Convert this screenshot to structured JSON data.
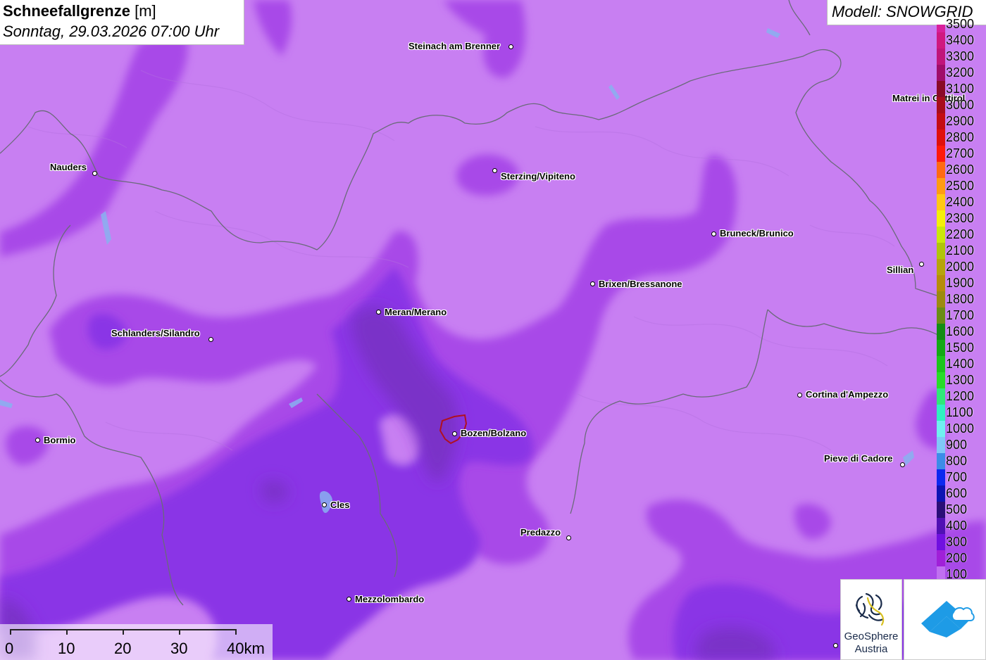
{
  "title": {
    "parameter": "Schneefallgrenze",
    "unit": "[m]",
    "datetime": "Sonntag, 29.03.2026 07:00 Uhr"
  },
  "model": "Modell: SNOWGRID",
  "cities": [
    {
      "name": "Steinach am Brenner"
    },
    {
      "name": "Matrei in Osttirol"
    },
    {
      "name": "Nauders"
    },
    {
      "name": "Sterzing/Vipiteno"
    },
    {
      "name": "Bruneck/Brunico"
    },
    {
      "name": "Sillian"
    },
    {
      "name": "Brixen/Bressanone"
    },
    {
      "name": "Meran/Merano"
    },
    {
      "name": "Schlanders/Silandro"
    },
    {
      "name": "Cortina d'Ampezzo"
    },
    {
      "name": "Bozen/Bolzano"
    },
    {
      "name": "Bormio"
    },
    {
      "name": "Pieve di Cadore"
    },
    {
      "name": "Cles"
    },
    {
      "name": "Predazzo"
    },
    {
      "name": "Mezzolombardo"
    }
  ],
  "legend": {
    "levels": [
      {
        "value": "3500",
        "color": "#d8209a"
      },
      {
        "value": "3400",
        "color": "#d01880"
      },
      {
        "value": "3300",
        "color": "#c0147a"
      },
      {
        "value": "3200",
        "color": "#a00c6a"
      },
      {
        "value": "3100",
        "color": "#8a0a28"
      },
      {
        "value": "3000",
        "color": "#a80c1c"
      },
      {
        "value": "2900",
        "color": "#c40c14"
      },
      {
        "value": "2800",
        "color": "#e0100c"
      },
      {
        "value": "2700",
        "color": "#ff1a0a"
      },
      {
        "value": "2600",
        "color": "#ff6a12"
      },
      {
        "value": "2500",
        "color": "#ff9c12"
      },
      {
        "value": "2400",
        "color": "#ffc814"
      },
      {
        "value": "2300",
        "color": "#f4f00a"
      },
      {
        "value": "2200",
        "color": "#cae80a"
      },
      {
        "value": "2100",
        "color": "#b0c40a"
      },
      {
        "value": "2000",
        "color": "#b6a40a"
      },
      {
        "value": "1900",
        "color": "#b68c0a"
      },
      {
        "value": "1800",
        "color": "#9c8a10"
      },
      {
        "value": "1700",
        "color": "#6a8c14"
      },
      {
        "value": "1600",
        "color": "#148c14"
      },
      {
        "value": "1500",
        "color": "#14a814"
      },
      {
        "value": "1400",
        "color": "#1cc41c"
      },
      {
        "value": "1300",
        "color": "#28dc28"
      },
      {
        "value": "1200",
        "color": "#30e878"
      },
      {
        "value": "1100",
        "color": "#30f0c0"
      },
      {
        "value": "1000",
        "color": "#70f0f0"
      },
      {
        "value": "900",
        "color": "#80c8f8"
      },
      {
        "value": "800",
        "color": "#3c8ce8"
      },
      {
        "value": "700",
        "color": "#0c28f0"
      },
      {
        "value": "600",
        "color": "#0c14b4"
      },
      {
        "value": "500",
        "color": "#2a0e78"
      },
      {
        "value": "400",
        "color": "#5010b4"
      },
      {
        "value": "300",
        "color": "#7010e0"
      },
      {
        "value": "200",
        "color": "#a020d8"
      },
      {
        "value": "100",
        "color": "#c070f0"
      }
    ]
  },
  "scale": {
    "labels": [
      "0",
      "10",
      "20",
      "30",
      "40km"
    ]
  },
  "logo": {
    "line1": "GeoSphere",
    "line2": "Austria"
  }
}
